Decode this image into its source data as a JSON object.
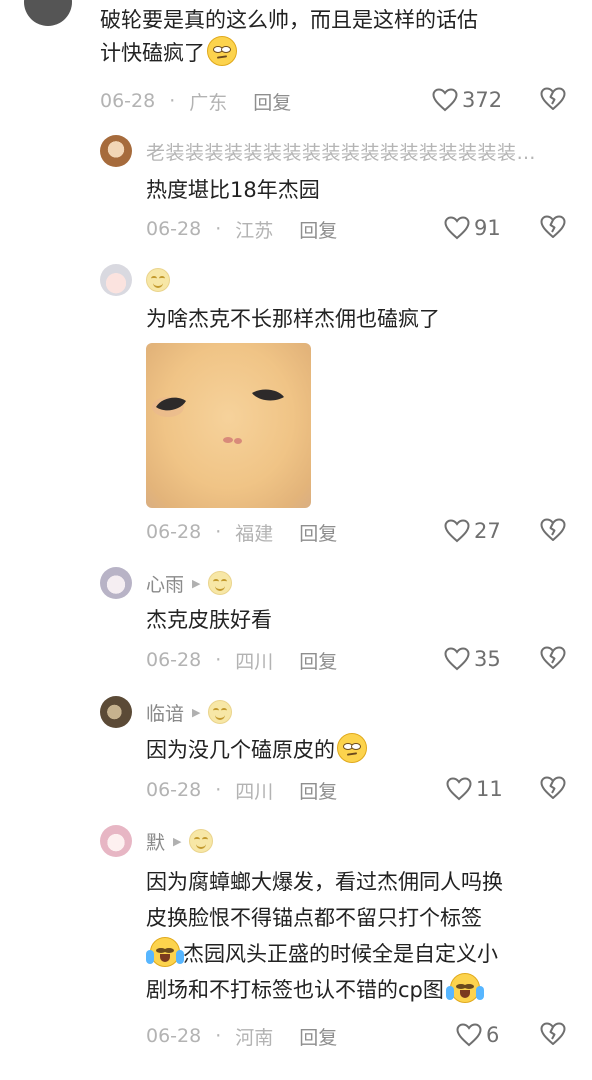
{
  "comments": [
    {
      "text_lines": [
        "破轮要是真的这么帅，而且是这样的话估",
        "计快磕疯了"
      ],
      "trailing_emoji": "eye-roll-emoji",
      "date": "06-28",
      "location": "广东",
      "reply_label": "回复",
      "like_count": "372"
    },
    {
      "username": "老装装装装装装装装装装装装装装装装装装…",
      "text": "热度堪比18年杰园",
      "date": "06-28",
      "location": "江苏",
      "reply_label": "回复",
      "like_count": "91"
    },
    {
      "text": "为啥杰克不长那样杰佣也磕疯了",
      "has_image": true,
      "date": "06-28",
      "location": "福建",
      "reply_label": "回复",
      "like_count": "27"
    },
    {
      "username": "心雨",
      "text": "杰克皮肤好看",
      "date": "06-28",
      "location": "四川",
      "reply_label": "回复",
      "like_count": "35"
    },
    {
      "username": "临谙",
      "text": "因为没几个磕原皮的",
      "trailing_emoji": "eye-roll-emoji",
      "date": "06-28",
      "location": "四川",
      "reply_label": "回复",
      "like_count": "11"
    },
    {
      "username": "默",
      "text_lines": [
        "因为腐蟑螂大爆发，看过杰佣同人吗换",
        "皮换脸恨不得锚点都不留只打个标签",
        "杰园风头正盛的时候全是自定义小",
        "剧场和不打标签也认不错的cp图"
      ],
      "date": "06-28",
      "location": "河南",
      "reply_label": "回复",
      "like_count": "6"
    }
  ],
  "colors": {
    "text": "#222222",
    "meta": "#b3b3b3",
    "icon": "#6f6f6f"
  }
}
